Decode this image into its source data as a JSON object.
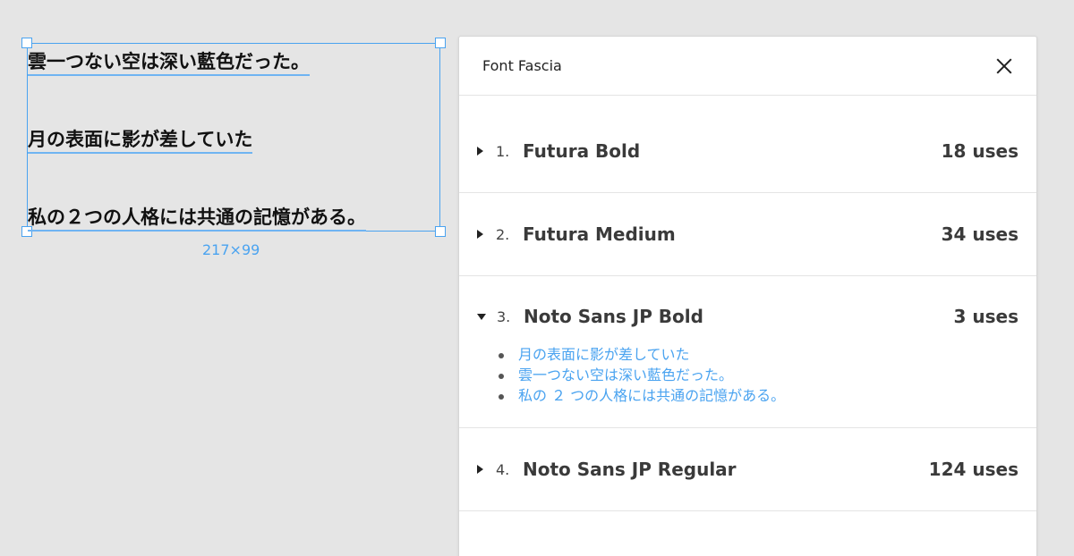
{
  "canvas": {
    "lines": [
      "雲一つない空は深い藍色だった。",
      "月の表面に影が差していた",
      "私の２つの人格には共通の記憶がある。"
    ],
    "dimensions": "217×99"
  },
  "panel": {
    "title": "Font Fascia",
    "close_icon": "close-icon",
    "fonts": [
      {
        "number": "1.",
        "name": "Futura Bold",
        "uses": "18 uses",
        "expanded": false
      },
      {
        "number": "2.",
        "name": "Futura Medium",
        "uses": "34 uses",
        "expanded": false
      },
      {
        "number": "3.",
        "name": "Noto Sans JP Bold",
        "uses": "3 uses",
        "expanded": true,
        "usages": [
          "月の表面に影が差していた",
          "雲一つない空は深い藍色だった。",
          "私の ２ つの人格には共通の記憶がある。"
        ]
      },
      {
        "number": "4.",
        "name": "Noto Sans JP Regular",
        "uses": "124 uses",
        "expanded": false
      }
    ]
  },
  "colors": {
    "selection": "#4aa3f0",
    "background": "#e5e5e5",
    "panel": "#ffffff"
  }
}
